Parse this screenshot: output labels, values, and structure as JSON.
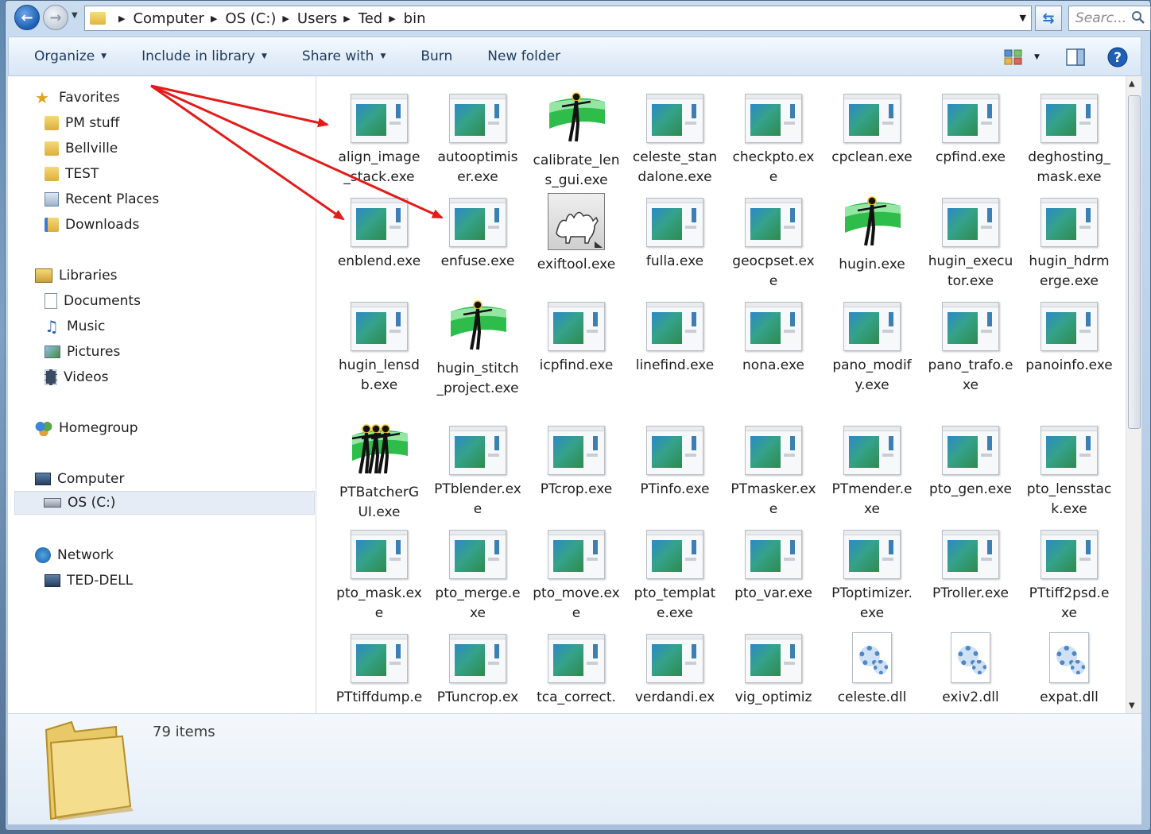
{
  "address": {
    "breadcrumbs": [
      "Computer",
      "OS (C:)",
      "Users",
      "Ted",
      "bin"
    ],
    "search_placeholder": "Searc..."
  },
  "toolbar": {
    "organize": "Organize",
    "include_in_library": "Include in library",
    "share_with": "Share with",
    "burn": "Burn",
    "new_folder": "New folder"
  },
  "nav": {
    "favorites": "Favorites",
    "pm_stuff": "PM stuff",
    "bellville": "Bellville",
    "test": "TEST",
    "recent_places": "Recent Places",
    "downloads": "Downloads",
    "libraries": "Libraries",
    "documents": "Documents",
    "music": "Music",
    "pictures": "Pictures",
    "videos": "Videos",
    "homegroup": "Homegroup",
    "computer": "Computer",
    "os_c": "OS (C:)",
    "network": "Network",
    "ted_dell": "TED-DELL"
  },
  "files": [
    {
      "name": "align_image_stack.exe",
      "icon": "app"
    },
    {
      "name": "autooptimiser.exe",
      "icon": "app"
    },
    {
      "name": "calibrate_lens_gui.exe",
      "icon": "hugin"
    },
    {
      "name": "celeste_standalone.exe",
      "icon": "app"
    },
    {
      "name": "checkpto.exe",
      "icon": "app"
    },
    {
      "name": "cpclean.exe",
      "icon": "app"
    },
    {
      "name": "cpfind.exe",
      "icon": "app"
    },
    {
      "name": "deghosting_mask.exe",
      "icon": "app"
    },
    {
      "name": "enblend.exe",
      "icon": "app"
    },
    {
      "name": "enfuse.exe",
      "icon": "app"
    },
    {
      "name": "exiftool.exe",
      "icon": "camel"
    },
    {
      "name": "fulla.exe",
      "icon": "app"
    },
    {
      "name": "geocpset.exe",
      "icon": "app"
    },
    {
      "name": "hugin.exe",
      "icon": "hugin"
    },
    {
      "name": "hugin_executor.exe",
      "icon": "app"
    },
    {
      "name": "hugin_hdrmerge.exe",
      "icon": "app"
    },
    {
      "name": "hugin_lensdb.exe",
      "icon": "app"
    },
    {
      "name": "hugin_stitch_project.exe",
      "icon": "hugin"
    },
    {
      "name": "icpfind.exe",
      "icon": "app"
    },
    {
      "name": "linefind.exe",
      "icon": "app"
    },
    {
      "name": "nona.exe",
      "icon": "app"
    },
    {
      "name": "pano_modify.exe",
      "icon": "app"
    },
    {
      "name": "pano_trafo.exe",
      "icon": "app"
    },
    {
      "name": "panoinfo.exe",
      "icon": "app"
    },
    {
      "name": "PTBatcherGUI.exe",
      "icon": "hugin-batch"
    },
    {
      "name": "PTblender.exe",
      "icon": "app"
    },
    {
      "name": "PTcrop.exe",
      "icon": "app"
    },
    {
      "name": "PTinfo.exe",
      "icon": "app"
    },
    {
      "name": "PTmasker.exe",
      "icon": "app"
    },
    {
      "name": "PTmender.exe",
      "icon": "app"
    },
    {
      "name": "pto_gen.exe",
      "icon": "app"
    },
    {
      "name": "pto_lensstack.exe",
      "icon": "app"
    },
    {
      "name": "pto_mask.exe",
      "icon": "app"
    },
    {
      "name": "pto_merge.exe",
      "icon": "app"
    },
    {
      "name": "pto_move.exe",
      "icon": "app"
    },
    {
      "name": "pto_template.exe",
      "icon": "app"
    },
    {
      "name": "pto_var.exe",
      "icon": "app"
    },
    {
      "name": "PToptimizer.exe",
      "icon": "app"
    },
    {
      "name": "PTroller.exe",
      "icon": "app"
    },
    {
      "name": "PTtiff2psd.exe",
      "icon": "app"
    },
    {
      "name": "PTtiffdump.exe",
      "icon": "app"
    },
    {
      "name": "PTuncrop.exe",
      "icon": "app"
    },
    {
      "name": "tca_correct.exe",
      "icon": "app"
    },
    {
      "name": "verdandi.exe",
      "icon": "app"
    },
    {
      "name": "vig_optimize.exe",
      "icon": "app"
    },
    {
      "name": "celeste.dll",
      "icon": "dll"
    },
    {
      "name": "exiv2.dll",
      "icon": "dll"
    },
    {
      "name": "expat.dll",
      "icon": "dll"
    }
  ],
  "status": {
    "item_count": "79 items"
  }
}
